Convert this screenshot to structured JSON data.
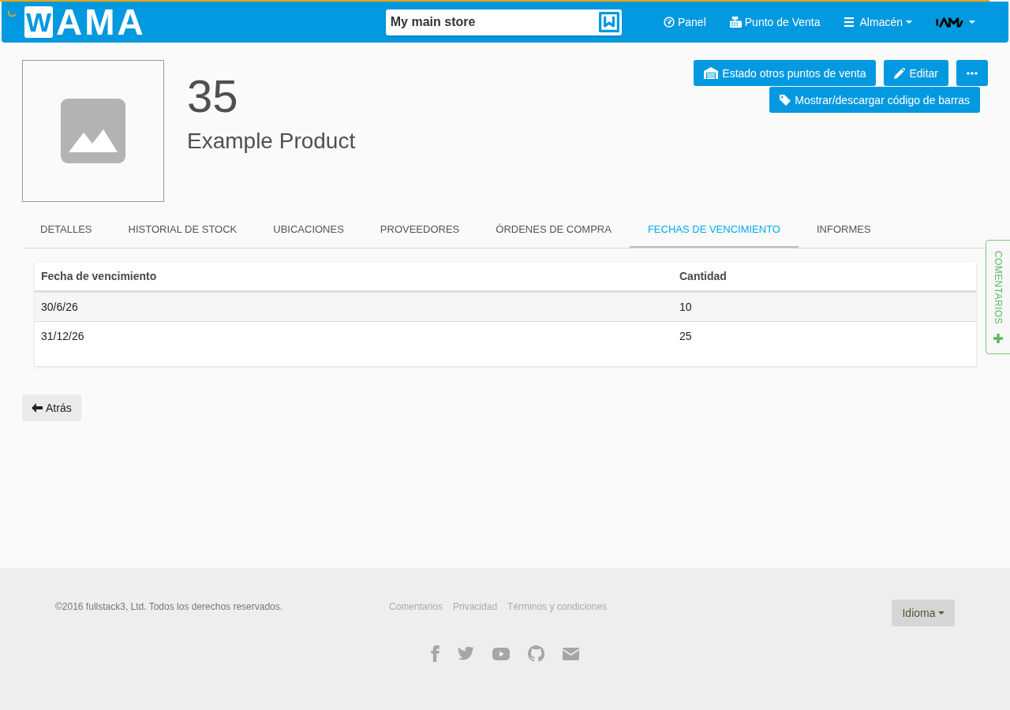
{
  "loading_bar": {
    "level": 0.98
  },
  "navbar": {
    "logo": {
      "mark": "W",
      "name": "AMA"
    },
    "store": {
      "value": "My main store"
    },
    "links": [
      {
        "kind": "link",
        "label": "Panel"
      },
      {
        "kind": "link",
        "label": "Punto de Venta"
      },
      {
        "kind": "dropdown",
        "label": "Almacén"
      },
      {
        "kind": "account"
      }
    ]
  },
  "product": {
    "code": "35",
    "name": "Example Product"
  },
  "action_rows": [
    [
      {
        "kind": "text",
        "label": "Estado otros puntos de venta"
      },
      {
        "kind": "text",
        "label": "Editar"
      },
      {
        "kind": "more"
      }
    ],
    [
      {
        "kind": "text",
        "label": "Mostrar/descargar código de barras"
      }
    ]
  ],
  "tabs": [
    {
      "label": "DETALLES",
      "selected": false
    },
    {
      "label": "HISTORIAL DE STOCK",
      "selected": false
    },
    {
      "label": "UBICACIONES",
      "selected": false
    },
    {
      "label": "PROVEEDORES",
      "selected": false
    },
    {
      "label": "ÓRDENES DE COMPRA",
      "selected": false
    },
    {
      "label": "FECHAS DE VENCIMIENTO",
      "selected": true
    },
    {
      "label": "INFORMES",
      "selected": false
    }
  ],
  "table": {
    "columns": [
      "Fecha de vencimiento",
      "Cantidad"
    ],
    "rows": [
      [
        "30/6/26",
        "10"
      ],
      [
        "31/12/26",
        "25"
      ]
    ]
  },
  "back_button": {
    "label": "Atrás"
  },
  "feedback_tab": {
    "label": "COMENTARIOS"
  },
  "footer": {
    "copyright": "©2016 fullstack3, Ltd. Todos los derechos reservados.",
    "links": [
      "Comentarios",
      "Privacidad",
      "Términos y condiciones"
    ],
    "language_button": {
      "label": "Idioma"
    }
  }
}
